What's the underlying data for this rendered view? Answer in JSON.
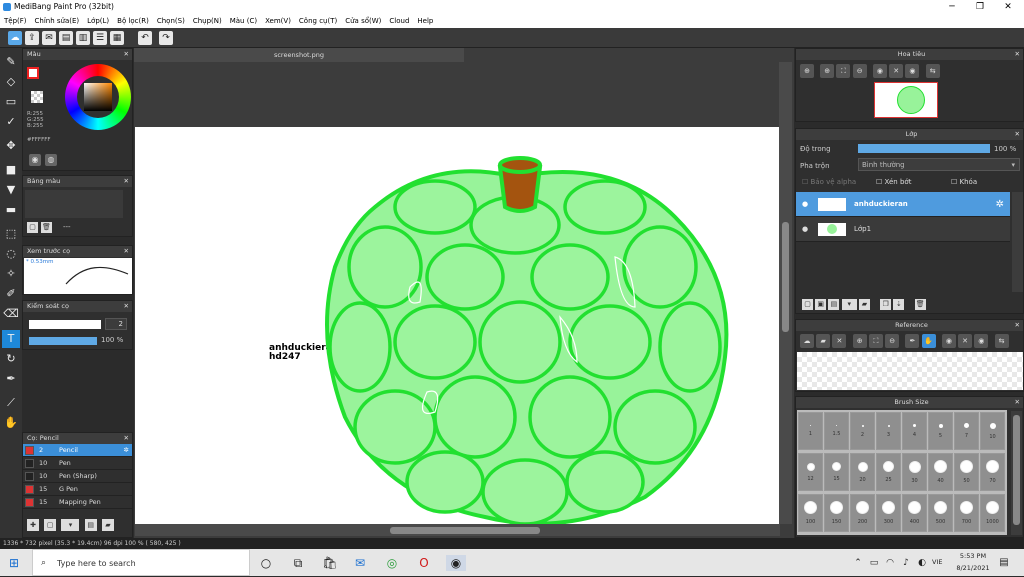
{
  "app": {
    "title": "MediBang Paint Pro (32bit)"
  },
  "menu": [
    "Tệp(F)",
    "Chỉnh sửa(E)",
    "Lớp(L)",
    "Bộ lọc(R)",
    "Chọn(S)",
    "Chụp(N)",
    "Màu (C)",
    "Xem(V)",
    "Công cụ(T)",
    "Cửa sổ(W)",
    "Cloud",
    "Help"
  ],
  "document": {
    "tab": "screenshot.png",
    "text_line1": "anhduckieran",
    "text_line2": "hd247"
  },
  "color_panel": {
    "title": "Màu",
    "rgb_r": "R:255",
    "rgb_g": "G:255",
    "rgb_b": "B:255",
    "hex": "#FFFFFF"
  },
  "palette_panel": {
    "title": "Bảng màu",
    "dash": "---"
  },
  "brush_preview": {
    "title": "Xem trước cọ",
    "size": "0.53mm"
  },
  "brush_control": {
    "title": "Kiểm soát cọ",
    "size": "2",
    "opacity": "100 %"
  },
  "brush_list": {
    "title": "Cọ: Pencil",
    "items": [
      {
        "size": "2",
        "name": "Pencil",
        "color": "#d33"
      },
      {
        "size": "10",
        "name": "Pen",
        "color": "#222"
      },
      {
        "size": "10",
        "name": "Pen (Sharp)",
        "color": "#222"
      },
      {
        "size": "15",
        "name": "G Pen",
        "color": "#d33"
      },
      {
        "size": "15",
        "name": "Mapping Pen",
        "color": "#d33"
      }
    ]
  },
  "navigator": {
    "title": "Hoa tiêu"
  },
  "layers": {
    "title": "Lớp",
    "opacity_label": "Độ trong",
    "opacity_value": "100 %",
    "blend_label": "Pha trộn",
    "blend_value": "Bình thường",
    "protect_alpha": "Bảo vệ alpha",
    "clipping": "Xén bớt",
    "lock": "Khóa",
    "items": [
      {
        "name": "anhduckieran",
        "selected": true
      },
      {
        "name": "Lớp1",
        "selected": false
      }
    ]
  },
  "reference": {
    "title": "Reference"
  },
  "brush_size": {
    "title": "Brush Size",
    "values": [
      "1",
      "1.5",
      "2",
      "3",
      "4",
      "5",
      "7",
      "10",
      "12",
      "15",
      "20",
      "25",
      "30",
      "40",
      "50",
      "70",
      "100",
      "150",
      "200",
      "300",
      "400",
      "500",
      "700",
      "1000"
    ]
  },
  "status": {
    "text": "1336 * 732 pixel  (35.3 * 19.4cm)  96 dpi  100 %  ( 580, 425 )"
  },
  "taskbar": {
    "search_placeholder": "Type here to search",
    "time": "5:53 PM",
    "date": "8/21/2021",
    "lang": "VIE"
  }
}
